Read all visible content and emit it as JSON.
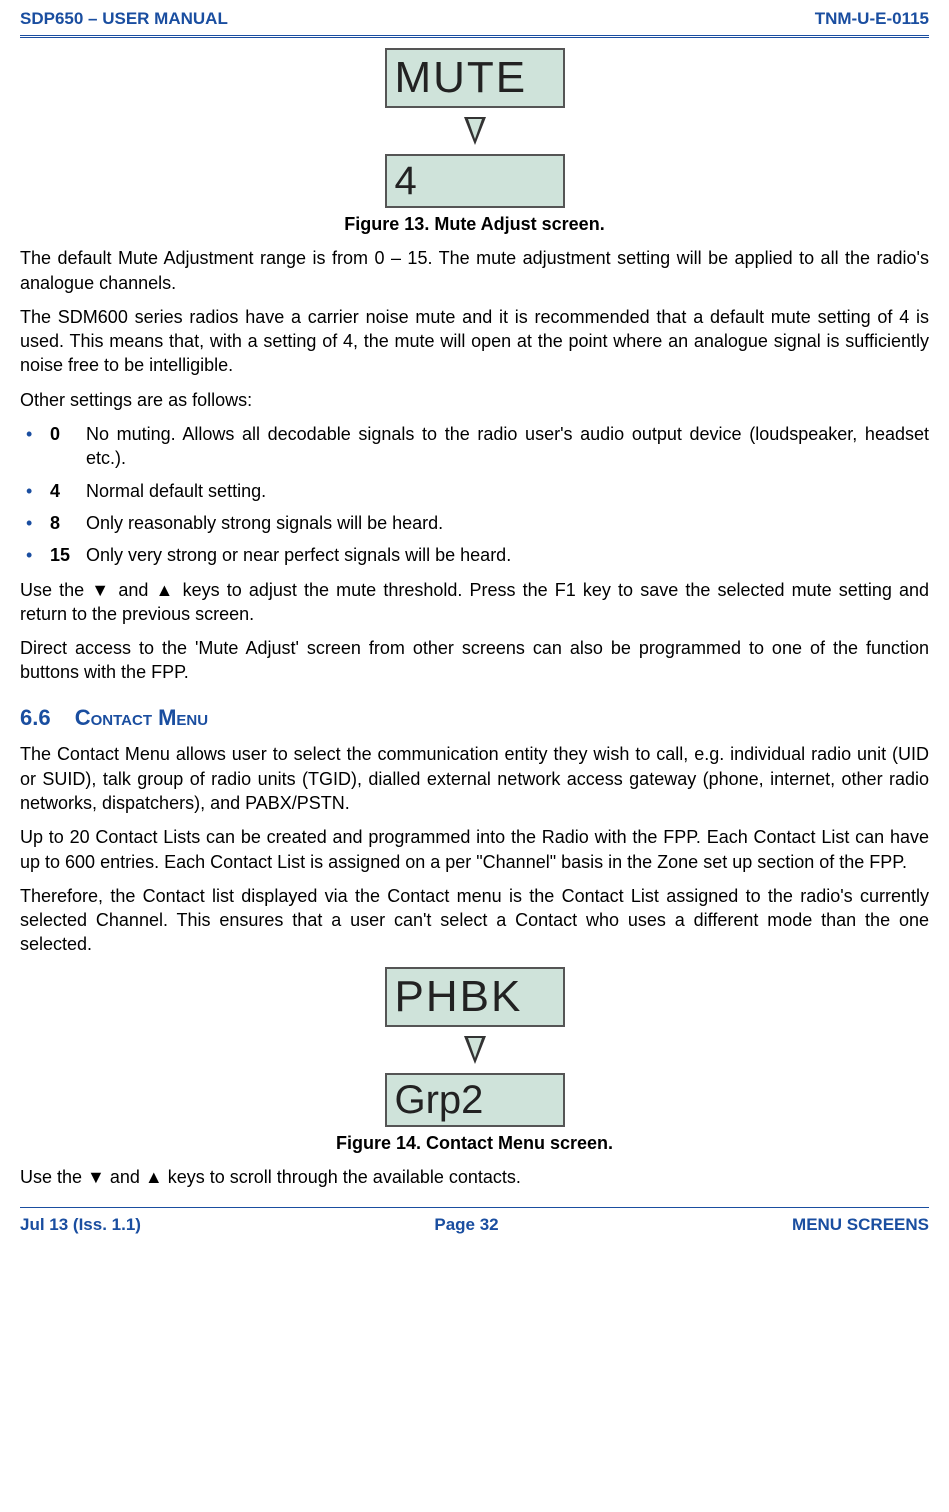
{
  "header": {
    "left": "SDP650 – USER MANUAL",
    "right": "TNM-U-E-0115"
  },
  "figure13": {
    "top": "MUTE",
    "bottom": "4",
    "caption": "Figure 13.  Mute Adjust screen."
  },
  "para1": "The default Mute Adjustment range is from 0 – 15.  The mute adjustment setting will be applied to all the radio's analogue channels.",
  "para2": "The SDM600 series radios have a carrier noise mute and it is recommended that a default mute setting of 4 is used.  This means that, with a setting of 4, the mute will open at the point where an analogue signal is sufficiently noise free to be intelligible.",
  "para3": "Other settings are as follows:",
  "settings": [
    {
      "num": "0",
      "text": "No muting.  Allows all decodable signals to the radio user's audio output device (loudspeaker, headset etc.)."
    },
    {
      "num": "4",
      "text": "Normal default setting."
    },
    {
      "num": "8",
      "text": "Only reasonably strong signals will be heard."
    },
    {
      "num": "15",
      "text": "Only very strong or near perfect signals will be heard."
    }
  ],
  "para4": "Use the ▼ and ▲ keys to adjust the mute threshold.  Press the F1 key to save the selected mute setting and return to the previous screen.",
  "para5": "Direct access to the 'Mute Adjust' screen from other screens can also be programmed to one of the function buttons with the FPP.",
  "section66": {
    "num": "6.6",
    "title": "Contact Menu"
  },
  "para6": "The Contact Menu allows user to select the communication entity they wish to call, e.g. individual radio unit (UID or SUID), talk group of radio units (TGID), dialled external network access gateway (phone, internet, other radio networks, dispatchers), and PABX/PSTN.",
  "para7": "Up to 20 Contact Lists can be created and programmed into the Radio with the FPP.  Each Contact List can have up to 600 entries.  Each Contact List is assigned on a per \"Channel\" basis in the Zone set up section of the FPP.",
  "para8": "Therefore, the Contact list displayed via the Contact menu is the Contact List assigned to the radio's currently selected Channel.  This ensures that a user can't select a Contact who uses a different mode than the one selected.",
  "figure14": {
    "top": "PHBK",
    "bottom": "Grp2",
    "caption": "Figure 14.  Contact Menu screen."
  },
  "para9": "Use the ▼ and ▲ keys to scroll through the available contacts.",
  "footer": {
    "left": "Jul 13 (Iss. 1.1)",
    "center": "Page 32",
    "right": "MENU SCREENS"
  }
}
